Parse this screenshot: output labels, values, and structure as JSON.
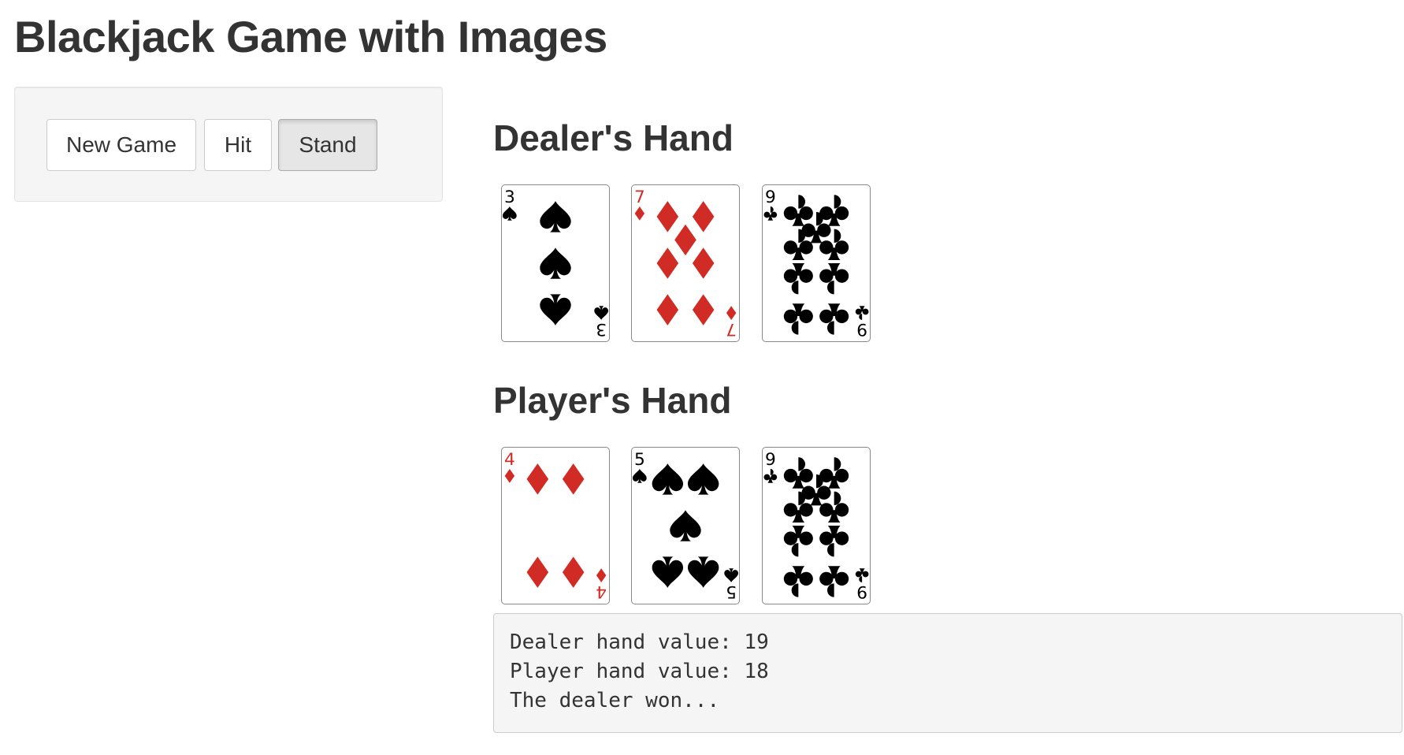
{
  "title": "Blackjack Game with Images",
  "controls": {
    "new_game_label": "New Game",
    "hit_label": "Hit",
    "stand_label": "Stand"
  },
  "dealer": {
    "heading": "Dealer's Hand",
    "cards": [
      {
        "rank": "3",
        "suit": "spades"
      },
      {
        "rank": "7",
        "suit": "diamonds"
      },
      {
        "rank": "9",
        "suit": "clubs"
      }
    ]
  },
  "player": {
    "heading": "Player's Hand",
    "cards": [
      {
        "rank": "4",
        "suit": "diamonds"
      },
      {
        "rank": "5",
        "suit": "spades"
      },
      {
        "rank": "9",
        "suit": "clubs"
      }
    ]
  },
  "status": {
    "lines": [
      "Dealer hand value: 19",
      "Player hand value: 18",
      "The dealer won..."
    ]
  },
  "colors": {
    "red_suit": "#d12b26",
    "black_suit": "#000000"
  }
}
